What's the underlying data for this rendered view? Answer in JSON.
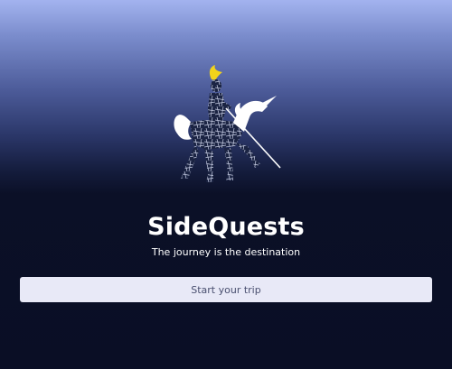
{
  "app": {
    "title": "SideQuests",
    "tagline": "The journey is the destination"
  },
  "start": {
    "placeholder": "Start your trip",
    "value": ""
  },
  "logo": {
    "icon": "knight-on-unicorn-icon",
    "plume_color": "#f2d31b",
    "body_color": "#ffffff",
    "map_color": "#1b2443"
  },
  "colors": {
    "background_top": "#a3b3ef",
    "background_bottom": "#0a0e25",
    "field_background": "#e8e9f7"
  }
}
